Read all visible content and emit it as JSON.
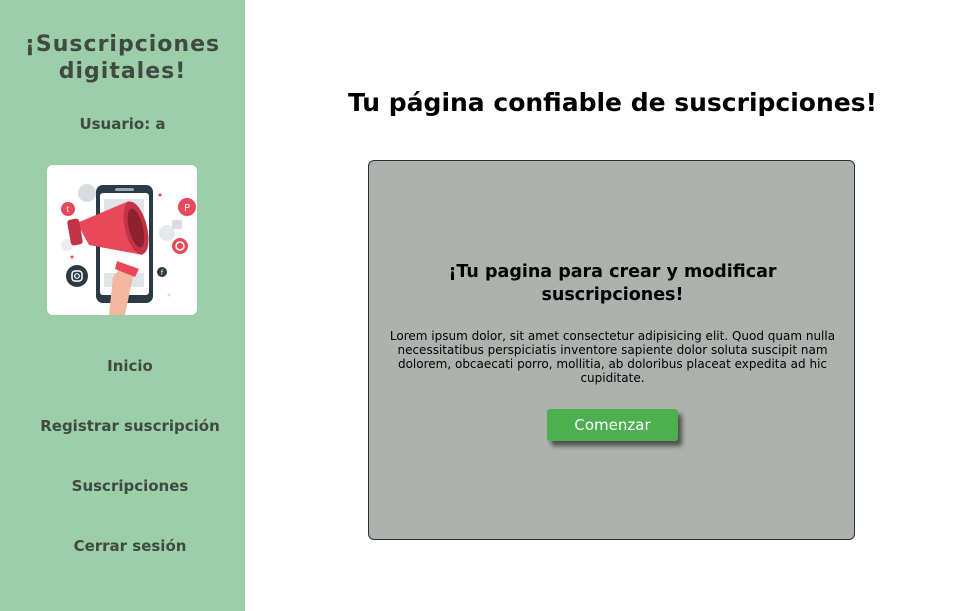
{
  "sidebar": {
    "brand": "¡Suscripciones digitales!",
    "user_label": "Usuario: a",
    "nav": [
      {
        "label": "Inicio"
      },
      {
        "label": "Registrar suscripción"
      },
      {
        "label": "Suscripciones"
      },
      {
        "label": "Cerrar sesión"
      }
    ]
  },
  "main": {
    "title": "Tu página confiable de suscripciones!",
    "card": {
      "title": "¡Tu pagina para crear y modificar suscripciones!",
      "text": "Lorem ipsum dolor, sit amet consectetur adipisicing elit. Quod quam nulla necessitatibus perspiciatis inventore sapiente dolor soluta suscipit nam dolorem, obcaecati porro, mollitia, ab doloribus placeat expedita ad hic cupiditate.",
      "button_label": "Comenzar"
    }
  },
  "colors": {
    "sidebar_bg": "#9ccea9",
    "card_bg": "#aeb2ae",
    "button_bg": "#4caf50",
    "megaphone": "#e8485a",
    "text_dark": "#3f4a41"
  },
  "icons": [
    "megaphone-phone-illustration",
    "twitter-icon",
    "pinterest-icon",
    "whatsapp-icon",
    "instagram-icon",
    "facebook-icon",
    "like-icon"
  ]
}
